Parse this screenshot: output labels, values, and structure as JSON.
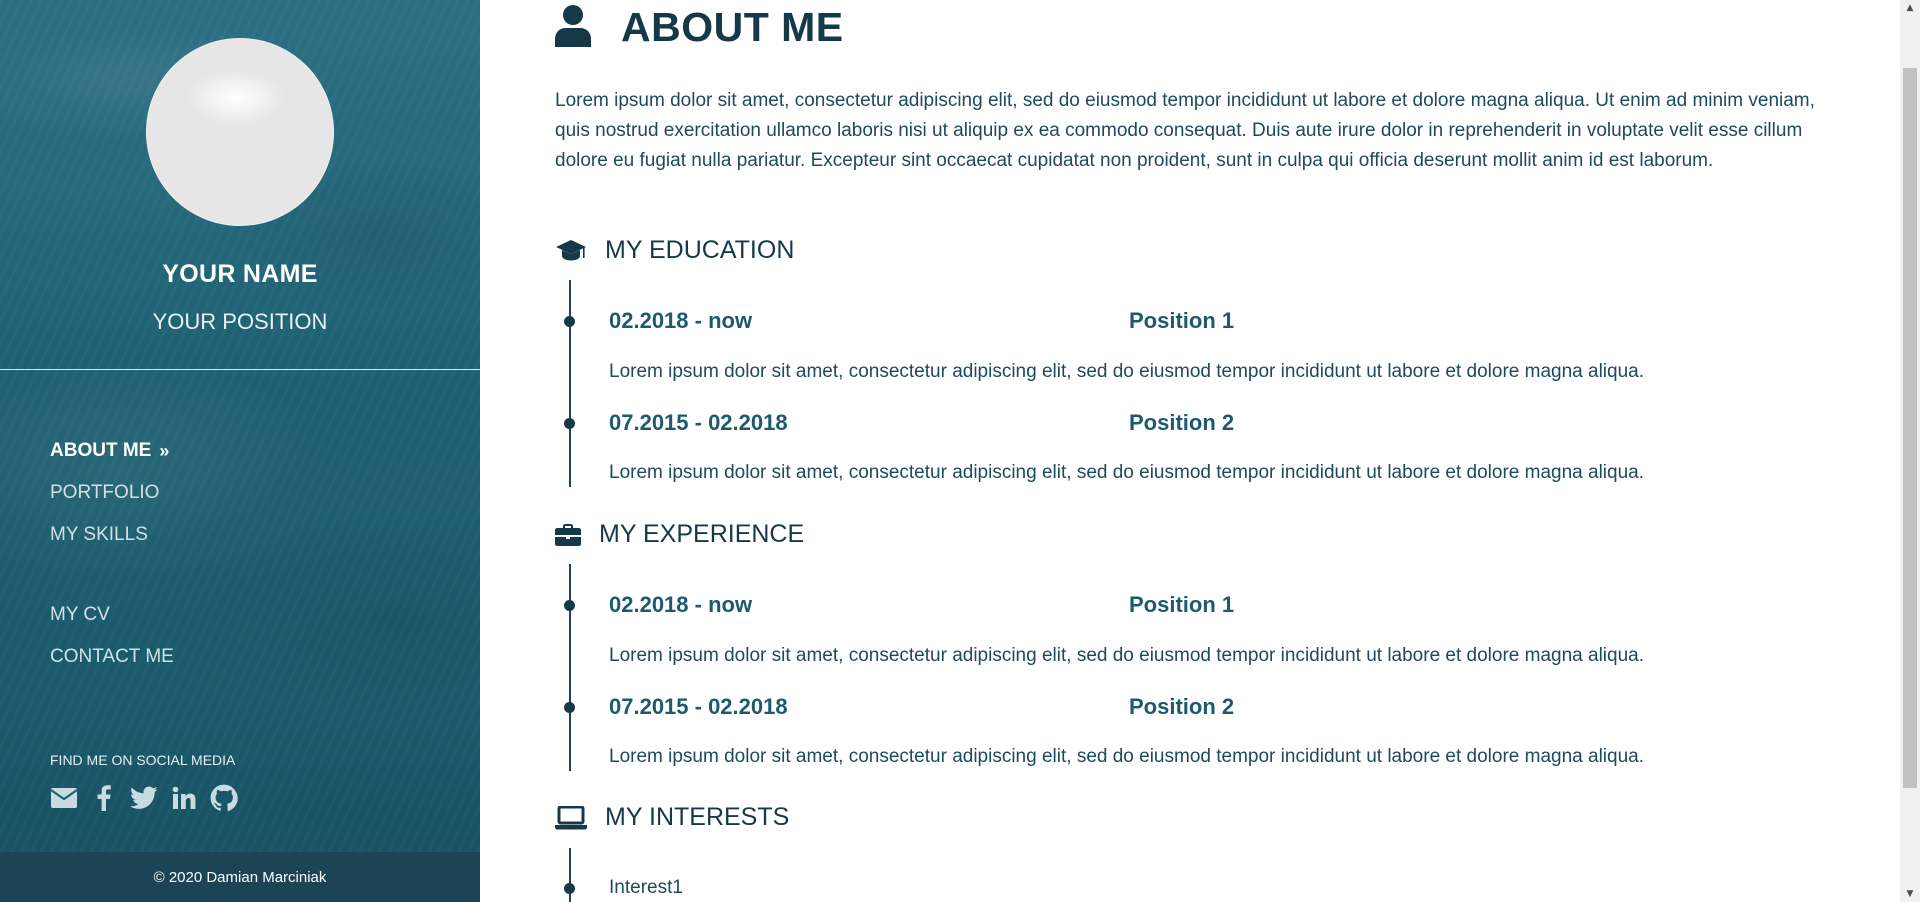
{
  "sidebar": {
    "name": "YOUR NAME",
    "position": "YOUR POSITION",
    "nav": {
      "about": "ABOUT ME",
      "about_chevron": "»",
      "portfolio": "PORTFOLIO",
      "skills": "MY SKILLS",
      "cv": "MY CV",
      "contact": "CONTACT ME"
    },
    "social_label": "FIND ME ON SOCIAL MEDIA",
    "social_icons": [
      "envelope-icon",
      "facebook-icon",
      "twitter-icon",
      "linkedin-icon",
      "github-icon"
    ],
    "footer": "© 2020 Damian Marciniak"
  },
  "main": {
    "title": "ABOUT ME",
    "about_text": "Lorem ipsum dolor sit amet, consectetur adipiscing elit, sed do eiusmod tempor incididunt ut labore et dolore magna aliqua. Ut enim ad minim veniam, quis nostrud exercitation ullamco laboris nisi ut aliquip ex ea commodo consequat. Duis aute irure dolor in reprehenderit in voluptate velit esse cillum dolore eu fugiat nulla pariatur. Excepteur sint occaecat cupidatat non proident, sunt in culpa qui officia deserunt mollit anim id est laborum.",
    "education": {
      "title": "MY EDUCATION",
      "entries": [
        {
          "date": "02.2018 - now",
          "position": "Position 1",
          "desc": "Lorem ipsum dolor sit amet, consectetur adipiscing elit, sed do eiusmod tempor incididunt ut labore et dolore magna aliqua."
        },
        {
          "date": "07.2015 - 02.2018",
          "position": "Position 2",
          "desc": "Lorem ipsum dolor sit amet, consectetur adipiscing elit, sed do eiusmod tempor incididunt ut labore et dolore magna aliqua."
        }
      ]
    },
    "experience": {
      "title": "MY EXPERIENCE",
      "entries": [
        {
          "date": "02.2018 - now",
          "position": "Position 1",
          "desc": "Lorem ipsum dolor sit amet, consectetur adipiscing elit, sed do eiusmod tempor incididunt ut labore et dolore magna aliqua."
        },
        {
          "date": "07.2015 - 02.2018",
          "position": "Position 2",
          "desc": "Lorem ipsum dolor sit amet, consectetur adipiscing elit, sed do eiusmod tempor incididunt ut labore et dolore magna aliqua."
        }
      ]
    },
    "interests": {
      "title": "MY INTERESTS",
      "items": [
        "Interest1"
      ]
    }
  },
  "colors": {
    "sidebar_bg": "#1f6173",
    "footer_bg": "#1c4454",
    "heading": "#16394a",
    "accent": "#1d5a70",
    "body_text": "#1e4a5c"
  }
}
